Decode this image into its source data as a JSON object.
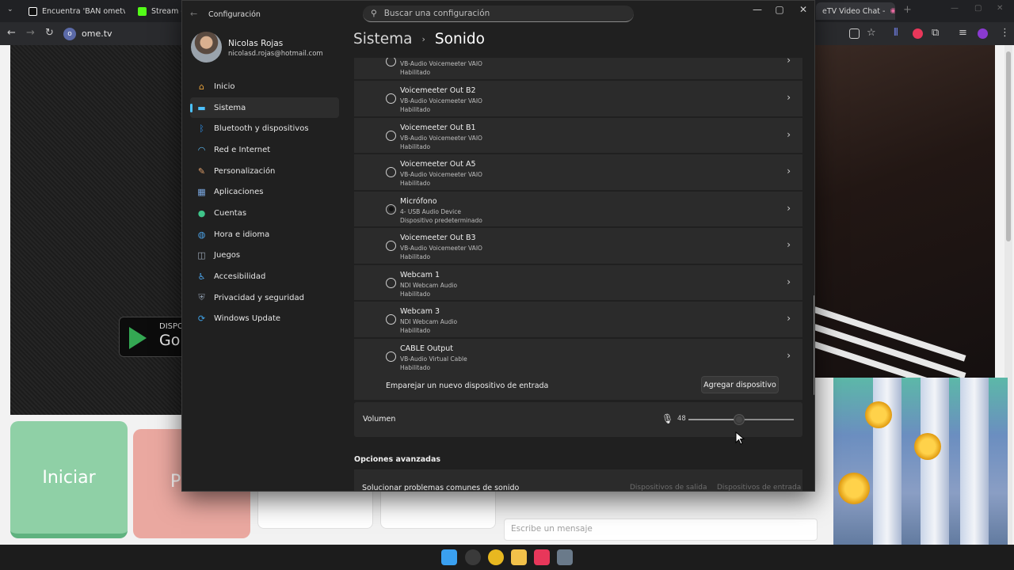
{
  "browser": {
    "tabs": [
      {
        "label": "Encuentra 'BAN ometv d",
        "color": "#111111"
      },
      {
        "label": "Stream - Ki",
        "color": "#53fc18"
      },
      {
        "label": "eTV Video Chat -",
        "color": "#2d2d2d"
      }
    ],
    "url": "ome.tv"
  },
  "page": {
    "start_button": "Iniciar",
    "second_button": "P",
    "play_line1": "DISPO",
    "play_line2": "Go",
    "message_placeholder": "Escribe un mensaje"
  },
  "settings": {
    "app_title": "Configuración",
    "search_placeholder": "Buscar una configuración",
    "user": {
      "name": "Nicolas Rojas",
      "email": "nicolasd.rojas@hotmail.com"
    },
    "nav": [
      {
        "label": "Inicio",
        "icon": "home-icon",
        "color": "#e8a23b"
      },
      {
        "label": "Sistema",
        "icon": "system-icon",
        "color": "#4cc2ff"
      },
      {
        "label": "Bluetooth y dispositivos",
        "icon": "bluetooth-icon",
        "color": "#2f8fe8"
      },
      {
        "label": "Red e Internet",
        "icon": "wifi-icon",
        "color": "#5cb8f0"
      },
      {
        "label": "Personalización",
        "icon": "brush-icon",
        "color": "#e3a06a"
      },
      {
        "label": "Aplicaciones",
        "icon": "apps-icon",
        "color": "#7aa7e0"
      },
      {
        "label": "Cuentas",
        "icon": "accounts-icon",
        "color": "#3fc58a"
      },
      {
        "label": "Hora e idioma",
        "icon": "globe-icon",
        "color": "#4ca3e8"
      },
      {
        "label": "Juegos",
        "icon": "gamepad-icon",
        "color": "#9aa6b4"
      },
      {
        "label": "Accesibilidad",
        "icon": "accessibility-icon",
        "color": "#4ca3e8"
      },
      {
        "label": "Privacidad y seguridad",
        "icon": "shield-icon",
        "color": "#8a96a6"
      },
      {
        "label": "Windows Update",
        "icon": "update-icon",
        "color": "#3fa2e8"
      }
    ],
    "breadcrumb": {
      "parent": "Sistema",
      "current": "Sonido"
    },
    "devices": [
      {
        "name": "",
        "sub": "VB-Audio Voicemeeter VAIO",
        "status": "Habilitado",
        "selected": false
      },
      {
        "name": "Voicemeeter Out B2",
        "sub": "VB-Audio Voicemeeter VAIO",
        "status": "Habilitado",
        "selected": false
      },
      {
        "name": "Voicemeeter Out B1",
        "sub": "VB-Audio Voicemeeter VAIO",
        "status": "Habilitado",
        "selected": false
      },
      {
        "name": "Voicemeeter Out A5",
        "sub": "VB-Audio Voicemeeter VAIO",
        "status": "Habilitado",
        "selected": false
      },
      {
        "name": "Micrófono",
        "sub": "4- USB Audio Device",
        "status": "Dispositivo predeterminado",
        "selected": true
      },
      {
        "name": "Voicemeeter Out B3",
        "sub": "VB-Audio Voicemeeter VAIO",
        "status": "Habilitado",
        "selected": false
      },
      {
        "name": "Webcam 1",
        "sub": "NDI Webcam Audio",
        "status": "Habilitado",
        "selected": false
      },
      {
        "name": "Webcam 3",
        "sub": "NDI Webcam Audio",
        "status": "Habilitado",
        "selected": false
      },
      {
        "name": "CABLE Output",
        "sub": "VB-Audio Virtual Cable",
        "status": "Habilitado",
        "selected": false
      }
    ],
    "pair_label": "Emparejar un nuevo dispositivo de entrada",
    "pair_button": "Agregar dispositivo",
    "volume": {
      "label": "Volumen",
      "value": "48",
      "level": 0.48
    },
    "advanced_title": "Opciones avanzadas",
    "troubleshoot": {
      "label": "Solucionar problemas comunes de sonido",
      "output_link": "Dispositivos de salida",
      "input_link": "Dispositivos de entrada"
    }
  },
  "taskbar": [
    {
      "icon": "windows-start-icon",
      "color": "#3aa0f0"
    },
    {
      "icon": "obs-icon",
      "color": "#3a3a3a"
    },
    {
      "icon": "chrome-icon",
      "color": "#e8b820"
    },
    {
      "icon": "file-explorer-icon",
      "color": "#f2c14a"
    },
    {
      "icon": "tiktok-icon",
      "color": "#e8375a"
    },
    {
      "icon": "settings-icon",
      "color": "#6a7a8a"
    }
  ]
}
